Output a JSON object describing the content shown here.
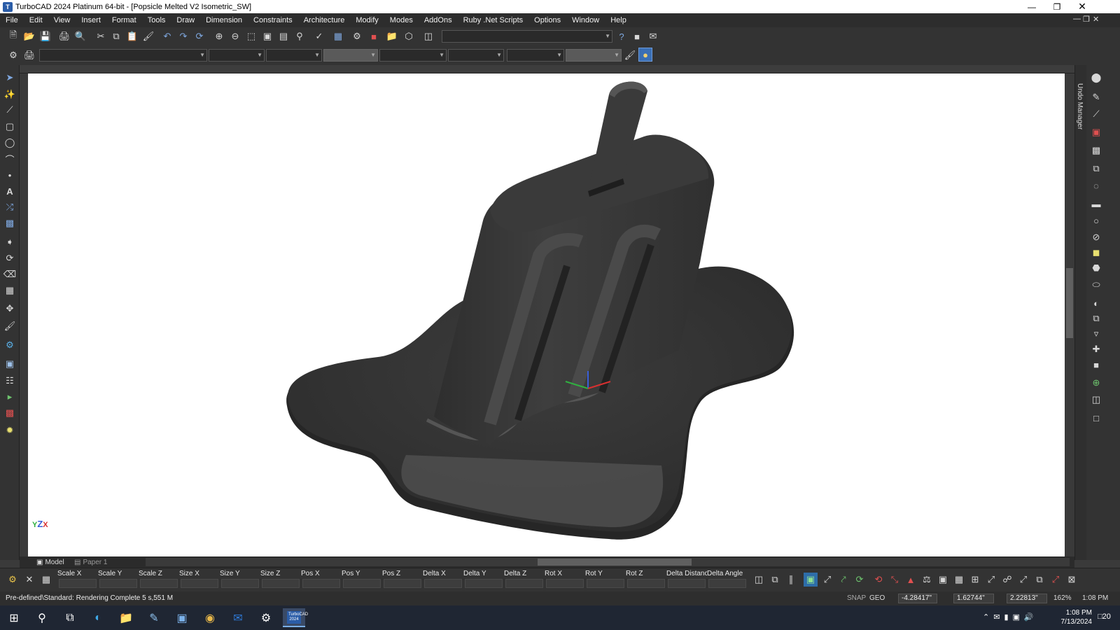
{
  "window": {
    "title": "TurboCAD 2024 Platinum 64-bit - [Popsicle Melted V2 Isometric_SW]",
    "app_icon_text": "T",
    "controls": [
      "minimize-icon",
      "maximize-icon",
      "close-icon"
    ]
  },
  "menu": {
    "items": [
      "File",
      "Edit",
      "View",
      "Insert",
      "Format",
      "Tools",
      "Draw",
      "Dimension",
      "Constraints",
      "Architecture",
      "Modify",
      "Modes",
      "AddOns",
      "Ruby .Net Scripts",
      "Options",
      "Window",
      "Help"
    ]
  },
  "undo_manager": {
    "label": "Undo Manager"
  },
  "viewport": {
    "axis_indicator": {
      "y": "Y",
      "z": "Z",
      "x": "X"
    },
    "model": "melted popsicle"
  },
  "tabs": {
    "model": "Model",
    "paper": "Paper 1"
  },
  "inspector": {
    "fields": [
      "Scale X",
      "Scale Y",
      "Scale Z",
      "Size X",
      "Size Y",
      "Size Z",
      "Pos X",
      "Pos Y",
      "Pos Z",
      "Delta X",
      "Delta Y",
      "Delta Z",
      "Rot X",
      "Rot Y",
      "Rot Z",
      "Delta Distance",
      "Delta Angle"
    ]
  },
  "status": {
    "message": "Pre-defined\\Standard: Rendering Complete 5 s,551 M",
    "snap": "SNAP",
    "geo": "GEO",
    "x": "-4.28417\"",
    "y": "1.62744\"",
    "z": "2.22813\"",
    "zoom": "162%",
    "time": "1:08 PM"
  },
  "taskbar": {
    "time": "1:08 PM",
    "date": "7/13/2024",
    "notifications": "20",
    "active_app_label": "TurboCAD 2024"
  },
  "colors": {
    "ui_dark": "#333333",
    "viewport_bg": "#ffffff",
    "model_shade": "#3a3a3a",
    "taskbar": "#1f2633"
  }
}
